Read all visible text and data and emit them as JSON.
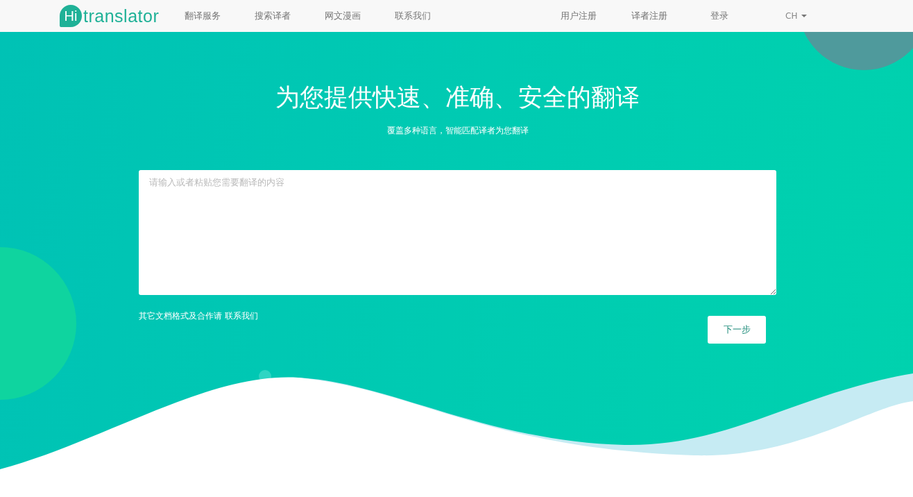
{
  "logo": {
    "mark": "Hi",
    "word": "translator"
  },
  "nav": {
    "left": [
      {
        "label": "翻译服务"
      },
      {
        "label": "搜索译者"
      },
      {
        "label": "网文漫画"
      },
      {
        "label": "联系我们"
      }
    ],
    "right": [
      {
        "label": "用户注册"
      },
      {
        "label": "译者注册"
      },
      {
        "label": "登录"
      }
    ],
    "language": {
      "label": "CH"
    }
  },
  "hero": {
    "title": "为您提供快速、准确、安全的翻译",
    "subtitle": "覆盖多种语言，智能匹配译者为您翻译",
    "input": {
      "placeholder": "请输入或者粘贴您需要翻译的内容"
    },
    "note": {
      "text": "其它文档格式及合作请 ",
      "link": "联系我们"
    },
    "next_button": "下一步"
  }
}
